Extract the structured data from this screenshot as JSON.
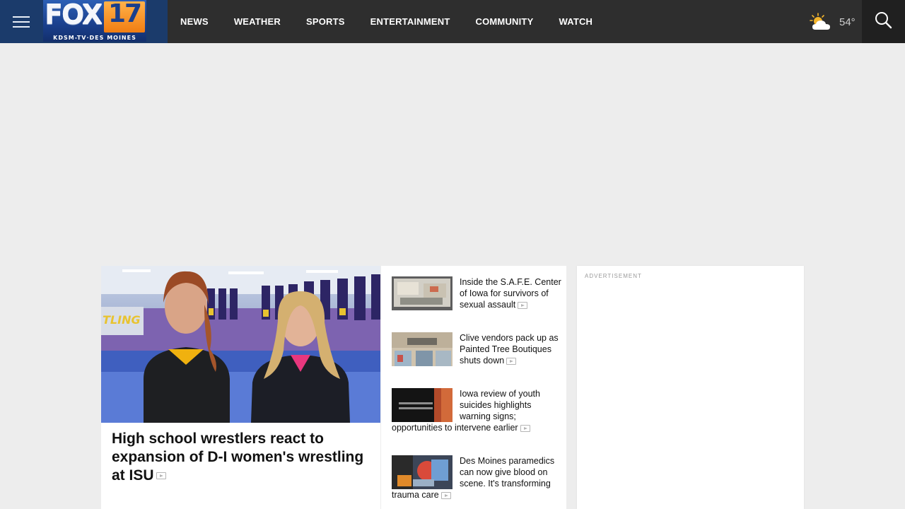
{
  "header": {
    "menu_icon": "hamburger-menu-icon",
    "logo": {
      "brand": "FOX",
      "channel_number": "17",
      "subtitle": "KDSM-TV·DES MOINES"
    },
    "nav": [
      "NEWS",
      "WEATHER",
      "SPORTS",
      "ENTERTAINMENT",
      "COMMUNITY",
      "WATCH"
    ],
    "weather": {
      "icon": "partly-cloudy-icon",
      "temperature": "54°"
    },
    "search_icon": "search-icon"
  },
  "lead_story": {
    "title": "High school wrestlers react to expansion of D-I women's wrestling at ISU",
    "image_description": "two-wrestlers-photo",
    "has_video": true
  },
  "stories": [
    {
      "title": "Inside the S.A.F.E. Center of Iowa for survivors of sexual assault",
      "has_video": true
    },
    {
      "title": "Clive vendors pack up as Painted Tree Boutiques shuts down",
      "has_video": true
    },
    {
      "title": "Iowa review of youth suicides highlights warning signs; opportunities to intervene earlier",
      "has_video": true
    },
    {
      "title": "Des Moines paramedics can now give blood on scene. It's transforming trauma care",
      "has_video": true
    }
  ],
  "ad": {
    "label": "ADVERTISEMENT"
  },
  "colors": {
    "header_bg": "#2e2e2e",
    "logo_bg": "#1b3b6b",
    "page_bg": "#ededed",
    "logo_accent": "#f17d12"
  }
}
